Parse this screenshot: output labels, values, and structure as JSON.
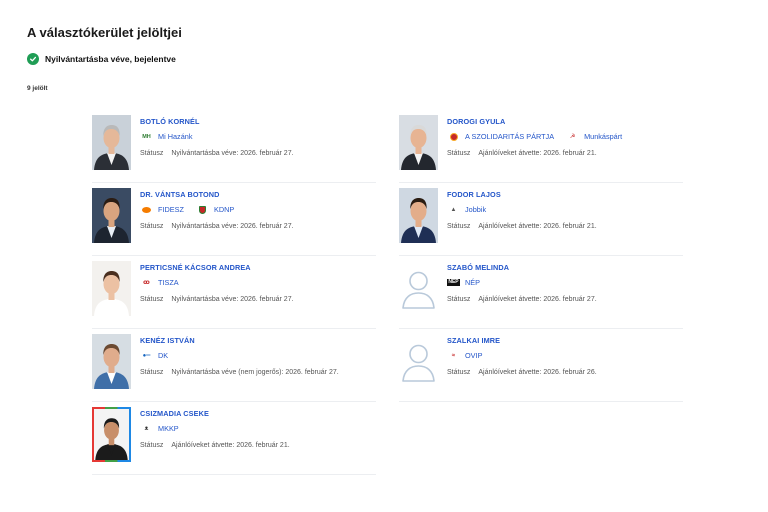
{
  "page": {
    "title": "A választókerület jelöltjei",
    "status": "Nyilvántartásba véve, bejelentve",
    "count": "9 jelölt",
    "status_color": "#1f9d55",
    "link_color": "#2456c9"
  },
  "status_key": "Státusz",
  "left": [
    {
      "name": "BOTLÓ KORNÉL",
      "photo": "portrait-photo",
      "parties": [
        {
          "name": "Mi Hazánk",
          "icon": "mi-hazank-logo",
          "color": "#2e7d32"
        }
      ],
      "status": "Nyilvántartásba véve: 2026. február 27."
    },
    {
      "name": "DR. VÁNTSA BOTOND",
      "photo": "portrait-photo",
      "parties": [
        {
          "name": "FIDESZ",
          "icon": "fidesz-logo",
          "color": "#f57c00"
        },
        {
          "name": "KDNP",
          "icon": "kdnp-logo",
          "color": "#c62828"
        }
      ],
      "status": "Nyilvántartásba véve: 2026. február 27."
    },
    {
      "name": "PERTICSNÉ KÁCSOR ANDREA",
      "photo": "portrait-photo",
      "parties": [
        {
          "name": "TISZA",
          "icon": "tisza-logo",
          "color": "#c62828"
        }
      ],
      "status": "Nyilvántartásba véve: 2026. február 27."
    },
    {
      "name": "KENÉZ ISTVÁN",
      "photo": "portrait-photo",
      "parties": [
        {
          "name": "DK",
          "icon": "dk-logo",
          "color": "#1565c0"
        }
      ],
      "status": "Nyilvántartásba véve (nem jogerős): 2026. február 27."
    },
    {
      "name": "CSIZMADIA CSEKE",
      "photo": "portrait-photo",
      "parties": [
        {
          "name": "MKKP",
          "icon": "mkkp-logo",
          "color": "#333333"
        }
      ],
      "status": "Ajánlóíveket átvette: 2026. február 21."
    }
  ],
  "right": [
    {
      "name": "DOROGI GYULA",
      "photo": "portrait-photo",
      "parties": [
        {
          "name": "A SZOLIDARITÁS PÁRTJA",
          "icon": "szolidaritas-logo",
          "color": "#c62828"
        },
        {
          "name": "Munkáspárt",
          "icon": "munkaspart-logo",
          "color": "#c62828"
        }
      ],
      "status": "Ajánlóíveket átvette: 2026. február 21."
    },
    {
      "name": "FODOR LAJOS",
      "photo": "portrait-photo",
      "parties": [
        {
          "name": "Jobbik",
          "icon": "jobbik-logo",
          "color": "#555555"
        }
      ],
      "status": "Ajánlóíveket átvette: 2026. február 21."
    },
    {
      "name": "SZABÓ MELINDA",
      "photo": "user-placeholder-icon",
      "parties": [
        {
          "name": "NÉP",
          "icon": "nep-logo",
          "color": "#111111"
        }
      ],
      "status": "Ajánlóíveket átvette: 2026. február 27."
    },
    {
      "name": "SZALKAI IMRE",
      "photo": "user-placeholder-icon",
      "parties": [
        {
          "name": "OVIP",
          "icon": "ovip-logo",
          "color": "#c62828"
        }
      ],
      "status": "Ajánlóíveket átvette: 2026. február 26."
    }
  ]
}
